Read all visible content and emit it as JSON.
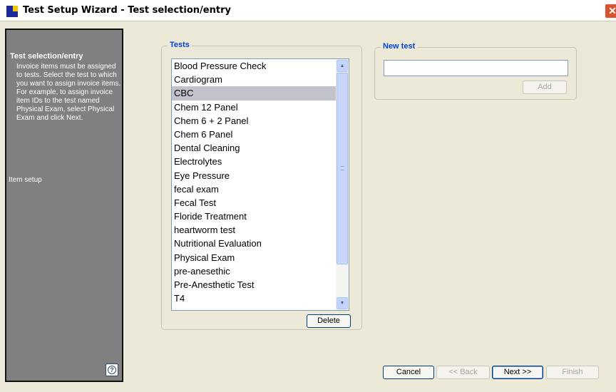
{
  "window": {
    "title": "Test Setup Wizard - Test selection/entry",
    "close_label": "✕"
  },
  "sidebar": {
    "title": "Test selection/entry",
    "description": "Invoice items must be assigned to tests. Select the test to which you want to assign invoice items. For example, to assign invoice item IDs to the test named Physical Exam, select Physical Exam and click Next.",
    "next_step": "Item setup",
    "help_glyph": "?"
  },
  "tests": {
    "group_label": "Tests",
    "items": [
      "Blood Pressure Check",
      "Cardiogram",
      "CBC",
      "Chem 12 Panel",
      "Chem 6 + 2 Panel",
      "Chem 6 Panel",
      "Dental Cleaning",
      "Electrolytes",
      "Eye Pressure",
      "fecal exam",
      "Fecal Test",
      "Floride Treatment",
      "heartworm test",
      "Nutritional Evaluation",
      "Physical Exam",
      "pre-anesethic",
      "Pre-Anesthetic Test",
      "T4"
    ],
    "selected_index": 2,
    "delete_label": "Delete"
  },
  "new_test": {
    "group_label": "New test",
    "value": "",
    "add_label": "Add"
  },
  "nav": {
    "cancel": "Cancel",
    "back": "<< Back",
    "next": "Next >>",
    "finish": "Finish"
  },
  "icons": {
    "scroll_up": "▲",
    "scroll_down": "▼"
  },
  "colors": {
    "group_label": "#0046d5",
    "sidebar_bg": "#808080",
    "selected_row": "#c1c2cb"
  }
}
